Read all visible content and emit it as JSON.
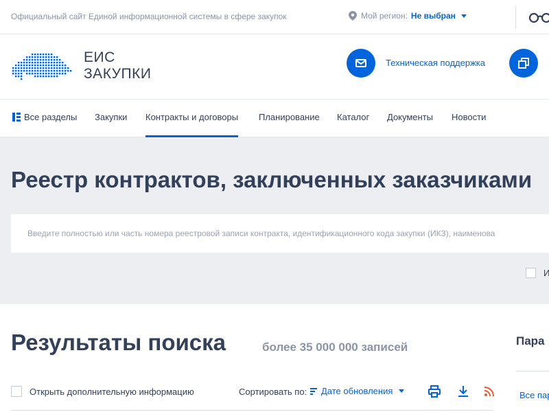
{
  "topbar": {
    "official_text": "Официальный сайт Единой информационной системы в сфере закупок",
    "region_label": "Мой регион:",
    "region_value": "Не выбран"
  },
  "brand": {
    "logo_line1": "ЕИС",
    "logo_line2": "ЗАКУПКИ",
    "support_label": "Техническая поддержка"
  },
  "nav": {
    "items": [
      "Все разделы",
      "Закупки",
      "Контракты и договоры",
      "Планирование",
      "Каталог",
      "Документы",
      "Новости"
    ],
    "active_index": 2
  },
  "hero": {
    "title": "Реестр контрактов, заключенных заказчиками",
    "search_placeholder": "Введите полностью или часть номера реестровой записи контракта, идентификационного кода закупки (ИКЗ), наименова",
    "check_label": "И"
  },
  "results": {
    "title": "Результаты поиска",
    "count": "более 35 000 000 записей",
    "open_info_label": "Открыть дополнительную информацию",
    "sort_label": "Сортировать по:",
    "sort_value": "Дате обновления"
  },
  "params": {
    "title": "Пара",
    "all_label": "Все пар"
  },
  "colors": {
    "accent": "#0065dd",
    "text": "#334059",
    "muted": "#8a94a6",
    "hero_bg": "#eceef2",
    "rss": "#e85b2a"
  }
}
